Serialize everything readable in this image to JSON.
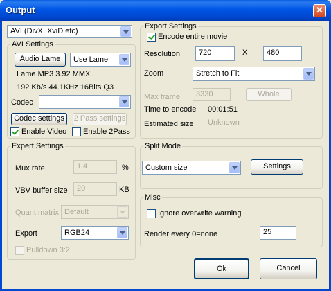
{
  "window": {
    "title": "Output"
  },
  "format": {
    "value": "AVI (DivX, XviD etc)"
  },
  "avi": {
    "legend": "AVI Settings",
    "audio_button": "Audio Lame",
    "audio_mode": "Use Lame",
    "audio_info1": "Lame MP3 3.92 MMX",
    "audio_info2": "192 Kb/s 44.1KHz 16Bits Q3",
    "codec_label": "Codec",
    "codec_value": "",
    "codec_settings_button": "Codec settings",
    "two_pass_button": "2 Pass settings",
    "enable_video_label": "Enable Video",
    "enable_video_checked": true,
    "enable_2pass_label": "Enable 2Pass",
    "enable_2pass_checked": false
  },
  "expert": {
    "legend": "Expert Settings",
    "mux_rate_label": "Mux rate",
    "mux_rate_value": "1.4",
    "mux_rate_unit": "%",
    "vbv_label": "VBV buffer size",
    "vbv_value": "20",
    "vbv_unit": "KB",
    "quant_label": "Quant matrix",
    "quant_value": "Default",
    "export_label": "Export",
    "export_value": "RGB24",
    "pulldown_label": "Pulldown 3:2",
    "pulldown_checked": false
  },
  "export": {
    "legend": "Export Settings",
    "encode_entire_label": "Encode entire movie",
    "encode_entire_checked": true,
    "resolution_label": "Resolution",
    "width": "720",
    "x_sep": "X",
    "height": "480",
    "zoom_label": "Zoom",
    "zoom_value": "Stretch to Fit",
    "max_frame_label": "Max frame",
    "max_frame_value": "3330",
    "whole_button": "Whole",
    "time_label": "Time to encode",
    "time_value": "00:01:51",
    "size_label": "Estimated size",
    "size_value": "Unknown"
  },
  "split": {
    "legend": "Split Mode",
    "mode_value": "Custom size",
    "settings_button": "Settings"
  },
  "misc": {
    "legend": "Misc",
    "ignore_label": "Ignore overwrite warning",
    "ignore_checked": false,
    "render_label": "Render every 0=none",
    "render_value": "25"
  },
  "footer": {
    "ok": "Ok",
    "cancel": "Cancel"
  }
}
